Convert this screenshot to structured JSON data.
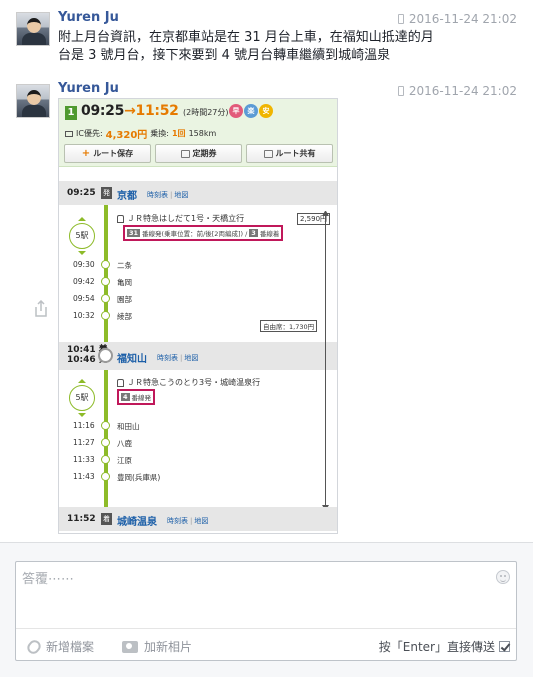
{
  "messages": [
    {
      "sender": "Yuren Ju",
      "timestamp": "2016-11-24 21:02",
      "text_line1": "附上月台資訊，在京都車站是在 31 月台上車，在福知山抵達的月",
      "text_line2": "台是 3 號月台，接下來要到 4 號月台轉車繼續到城崎溫泉"
    },
    {
      "sender": "Yuren Ju",
      "timestamp": "2016-11-24 21:02"
    }
  ],
  "route": {
    "number": "1",
    "depart": "09:25",
    "arrive": "11:52",
    "duration": "(2時間27分)",
    "badges": [
      {
        "label": "早",
        "color": "#e25a7a"
      },
      {
        "label": "楽",
        "color": "#5b9bd5"
      },
      {
        "label": "安",
        "color": "#f0b500"
      }
    ],
    "ic_label": "IC優先:",
    "fare": "4,320円",
    "transfer_label": "乗換:",
    "transfers": "1回",
    "distance": "158km",
    "buttons": [
      "ルート保存",
      "定期券",
      "ルート共有"
    ],
    "origin": {
      "time": "09:25",
      "mark": "発",
      "name": "京都"
    },
    "transfer_station": {
      "arr_time": "10:41",
      "arr_mark": "着",
      "dep_time": "10:46",
      "dep_mark": "発",
      "name": "福知山"
    },
    "destination": {
      "time": "11:52",
      "mark": "着",
      "name": "城崎温泉"
    },
    "link_timetable": "時刻表",
    "link_map": "地図",
    "segment1": {
      "stops": "5駅",
      "train": "ＪＲ特急はしだて1号・天橋立行",
      "platform_num": "31",
      "platform_text": "番線発(乗車位置：前/後[2両編成]) /",
      "arrival_platform_num": "3",
      "arrival_platform_text": "番線着",
      "fare": "2,590円",
      "seat": "自由席：1,730円",
      "intermediate": [
        {
          "time": "09:30",
          "name": "二条"
        },
        {
          "time": "09:42",
          "name": "亀岡"
        },
        {
          "time": "09:54",
          "name": "園部"
        },
        {
          "time": "10:32",
          "name": "綾部"
        }
      ]
    },
    "segment2": {
      "stops": "5駅",
      "train": "ＪＲ特急こうのとり3号・城崎温泉行",
      "platform_num": "4",
      "platform_text": "番線発",
      "intermediate": [
        {
          "time": "11:16",
          "name": "和田山"
        },
        {
          "time": "11:27",
          "name": "八鹿"
        },
        {
          "time": "11:33",
          "name": "江原"
        },
        {
          "time": "11:43",
          "name": "豊岡(兵庫県)"
        }
      ]
    }
  },
  "composer": {
    "placeholder": "答覆⋯⋯",
    "add_file": "新增檔案",
    "add_photo": "加新相片",
    "enter_send": "按「Enter」直接傳送"
  }
}
